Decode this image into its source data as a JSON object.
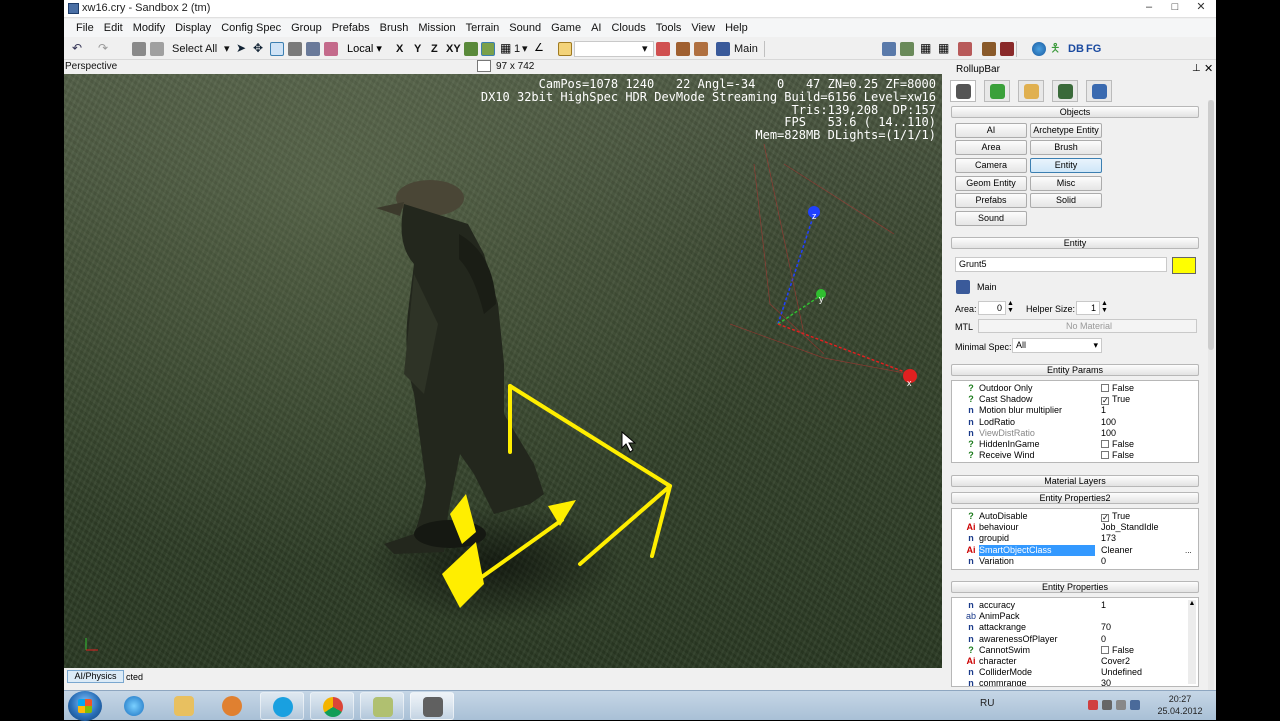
{
  "window": {
    "title": "xw16.cry - Sandbox 2 (tm)",
    "buttons": [
      "–",
      "□",
      "✕"
    ]
  },
  "menubar": [
    "File",
    "Edit",
    "Modify",
    "Display",
    "Config Spec",
    "Group",
    "Prefabs",
    "Brush",
    "Mission",
    "Terrain",
    "Sound",
    "Game",
    "AI",
    "Clouds",
    "Tools",
    "View",
    "Help"
  ],
  "toolbar": {
    "select_all": "Select All",
    "coord_system": "Local",
    "axes": [
      "X",
      "Y",
      "Z",
      "XY"
    ],
    "snap_value": "1",
    "layer": "Main",
    "right_labels": [
      "DB",
      "FG"
    ]
  },
  "viewport": {
    "label": "Perspective",
    "size": "97 x 742",
    "hud": [
      "CamPos=1078 1240   22 Angl=-34   0   47 ZN=0.25 ZF=8000",
      "DX10 32bit HighSpec HDR DevMode Streaming Build=6156 Level=xw16",
      "Tris:139,208  DP:157",
      "FPS   53.6 ( 14..110)",
      "Mem=828MB DLights=(1/1/1)"
    ],
    "gizmo_labels": {
      "z": "z",
      "y": "y",
      "x": "x"
    }
  },
  "rollup": {
    "title": "RollupBar",
    "objects_header": "Objects",
    "object_buttons": [
      "AI",
      "Archetype Entity",
      "Area",
      "Brush",
      "Camera",
      "Entity",
      "Geom Entity",
      "Misc",
      "Prefabs",
      "Solid",
      "Sound"
    ],
    "active_object": "Entity",
    "entity_header": "Entity",
    "entity_name": "Grunt5",
    "entity_color": "#ffff00",
    "layer": "Main",
    "area_label": "Area:",
    "area_value": "0",
    "helper_label": "Helper Size:",
    "helper_value": "1",
    "mtl_label": "MTL",
    "mtl_value": "No Material",
    "min_spec_label": "Minimal Spec:",
    "min_spec_value": "All",
    "entity_params_header": "Entity Params",
    "entity_params": [
      {
        "icon": "?",
        "name": "Outdoor Only",
        "value": "False",
        "check": false
      },
      {
        "icon": "?",
        "name": "Cast Shadow",
        "value": "True",
        "check": true
      },
      {
        "icon": "n",
        "name": "Motion blur multiplier",
        "value": "1"
      },
      {
        "icon": "n",
        "name": "LodRatio",
        "value": "100"
      },
      {
        "icon": "n",
        "name": "ViewDistRatio",
        "value": "100",
        "dim": true
      },
      {
        "icon": "?",
        "name": "HiddenInGame",
        "value": "False",
        "check": false
      },
      {
        "icon": "?",
        "name": "Receive Wind",
        "value": "False",
        "check": false
      }
    ],
    "material_layers_header": "Material Layers",
    "entity_props2_header": "Entity Properties2",
    "entity_props2": [
      {
        "icon": "?",
        "name": "AutoDisable",
        "value": "True",
        "check": true
      },
      {
        "icon": "Ai",
        "name": "behaviour",
        "value": "Job_StandIdle"
      },
      {
        "icon": "n",
        "name": "groupid",
        "value": "173"
      },
      {
        "icon": "Ai",
        "name": "SmartObjectClass",
        "value": "Cleaner",
        "selected": true,
        "extra": "..."
      },
      {
        "icon": "n",
        "name": "Variation",
        "value": "0"
      }
    ],
    "entity_props_header": "Entity Properties",
    "entity_props": [
      {
        "icon": "n",
        "name": "accuracy",
        "value": "1"
      },
      {
        "icon": "ab",
        "name": "AnimPack",
        "value": ""
      },
      {
        "icon": "n",
        "name": "attackrange",
        "value": "70"
      },
      {
        "icon": "n",
        "name": "awarenessOfPlayer",
        "value": "0"
      },
      {
        "icon": "?",
        "name": "CannotSwim",
        "value": "False",
        "check": false
      },
      {
        "icon": "Ai",
        "name": "character",
        "value": "Cover2"
      },
      {
        "icon": "n",
        "name": "ColliderMode",
        "value": "Undefined"
      },
      {
        "icon": "n",
        "name": "commrange",
        "value": "30"
      }
    ]
  },
  "statusbar": {
    "tab": "AI/Physics",
    "text": "cted"
  },
  "taskbar": {
    "lang": "RU",
    "time": "20:27",
    "date": "25.04.2012",
    "apps": [
      "internet-explorer",
      "explorer",
      "media-player",
      "skype",
      "chrome",
      "notepad",
      "sandbox-editor"
    ]
  }
}
